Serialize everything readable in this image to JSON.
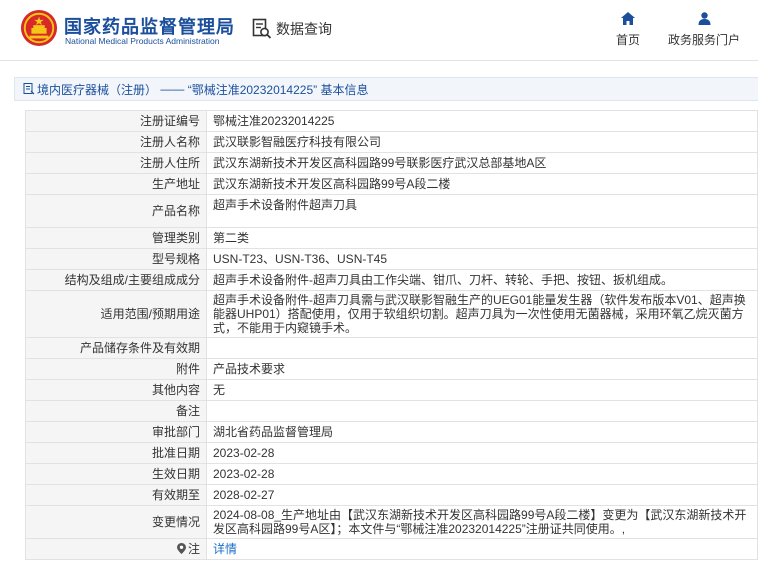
{
  "header": {
    "brand_cn": "国家药品监督管理局",
    "brand_en": "National Medical Products Administration",
    "data_query": "数据查询",
    "nav": [
      {
        "label": "首页",
        "icon": "home-icon"
      },
      {
        "label": "政务服务门户",
        "icon": "user-icon"
      }
    ]
  },
  "breadcrumb": {
    "icon": "document-icon",
    "category": "境内医疗器械（注册）",
    "separator": "——",
    "title": "“鄂械注准20232014225” 基本信息"
  },
  "rows": [
    {
      "label": "注册证编号",
      "value": "鄂械注准20232014225"
    },
    {
      "label": "注册人名称",
      "value": "武汉联影智融医疗科技有限公司"
    },
    {
      "label": "注册人住所",
      "value": "武汉东湖新技术开发区高科园路99号联影医疗武汉总部基地A区"
    },
    {
      "label": "生产地址",
      "value": "武汉东湖新技术开发区高科园路99号A段二楼"
    },
    {
      "label": "产品名称",
      "value": "超声手术设备附件超声刀具"
    },
    {
      "label": "管理类别",
      "value": "第二类"
    },
    {
      "label": "型号规格",
      "value": "USN-T23、USN-T36、USN-T45"
    },
    {
      "label": "结构及组成/主要组成成分",
      "value": "超声手术设备附件-超声刀具由工作尖端、钳爪、刀杆、转轮、手把、按钮、扳机组成。"
    },
    {
      "label": "适用范围/预期用途",
      "value": "超声手术设备附件-超声刀具需与武汉联影智融生产的UEG01能量发生器（软件发布版本V01、超声换能器UHP01）搭配使用，仅用于软组织切割。超声刀具为一次性使用无菌器械，采用环氧乙烷灭菌方式，不能用于内窥镜手术。"
    },
    {
      "label": "产品储存条件及有效期",
      "value": ""
    },
    {
      "label": "附件",
      "value": "产品技术要求"
    },
    {
      "label": "其他内容",
      "value": "无"
    },
    {
      "label": "备注",
      "value": ""
    },
    {
      "label": "审批部门",
      "value": "湖北省药品监督管理局"
    },
    {
      "label": "批准日期",
      "value": "2023-02-28"
    },
    {
      "label": "生效日期",
      "value": "2023-02-28"
    },
    {
      "label": "有效期至",
      "value": "2028-02-27"
    },
    {
      "label": "变更情况",
      "value": "2024-08-08_生产地址由【武汉东湖新技术开发区高科园路99号A段二楼】变更为【武汉东湖新技术开发区高科园路99号A区】；本文件与“鄂械注准20232014225”注册证共同使用。,"
    },
    {
      "label": "注",
      "value": "详情",
      "icon": "pin-icon"
    }
  ],
  "colors": {
    "brand_blue": "#1b4f9c",
    "logo_red": "#d7282a",
    "logo_gold": "#f5c518",
    "link_blue": "#1b6fc9",
    "label_bg": "#f5f5f5",
    "border": "#e2e2e2"
  }
}
